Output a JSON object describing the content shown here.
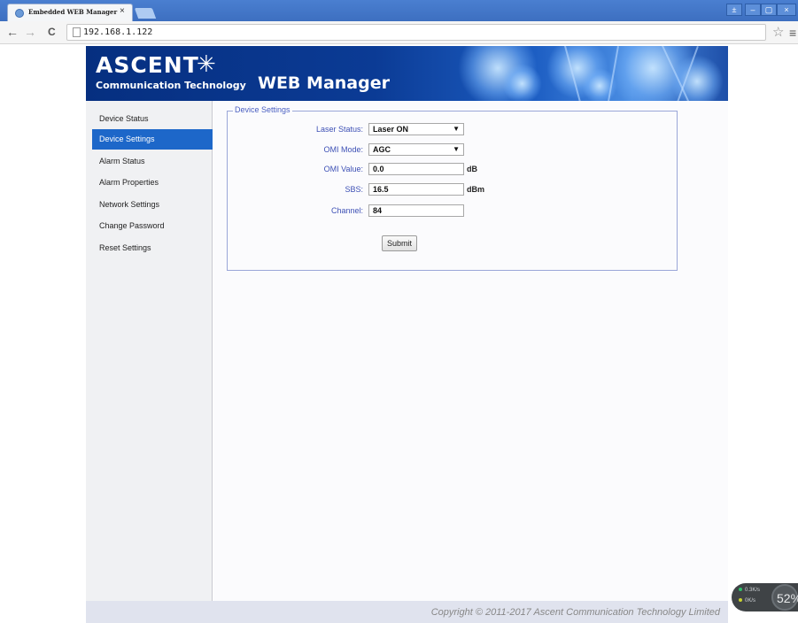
{
  "browser": {
    "tab_title": "Embedded WEB Manager",
    "tab_close": "×",
    "back": "←",
    "forward": "→",
    "reload": "C",
    "url": "192.168.1.122",
    "star": "☆",
    "menu": "≡",
    "window_controls": [
      "±",
      "–",
      "▢",
      "×"
    ]
  },
  "header": {
    "logo_main": "ASCENT",
    "logo_star": "✳",
    "logo_sub": "Communication Technology",
    "app_title": "WEB Manager"
  },
  "sidebar": {
    "items": [
      {
        "label": "Device Status"
      },
      {
        "label": "Device Settings",
        "active": true
      },
      {
        "label": "Alarm Status"
      },
      {
        "label": "Alarm Properties"
      },
      {
        "label": "Network Settings"
      },
      {
        "label": "Change Password"
      },
      {
        "label": "Reset Settings"
      }
    ]
  },
  "form": {
    "legend": "Device Settings",
    "laser_status": {
      "label": "Laser Status:",
      "value": "Laser ON"
    },
    "omi_mode": {
      "label": "OMI Mode:",
      "value": "AGC"
    },
    "omi_value": {
      "label": "OMI Value:",
      "value": "0.0",
      "unit": "dB"
    },
    "sbs": {
      "label": "SBS:",
      "value": "16.5",
      "unit": "dBm"
    },
    "channel": {
      "label": "Channel:",
      "value": "84"
    },
    "submit_label": "Submit",
    "select_arrow": "▼"
  },
  "footer": {
    "copyright": "Copyright © 2011-2017 Ascent Communication Technology Limited"
  },
  "net_widget": {
    "upload": "0.3K/s",
    "download": "0K/s",
    "percent": "52%",
    "colors": {
      "upload": "#2fc06a",
      "download": "#c8d22f"
    }
  },
  "colors": {
    "accent": "#1d67c9",
    "label_blue": "#3d50b5",
    "banner": "#0b3b95"
  }
}
